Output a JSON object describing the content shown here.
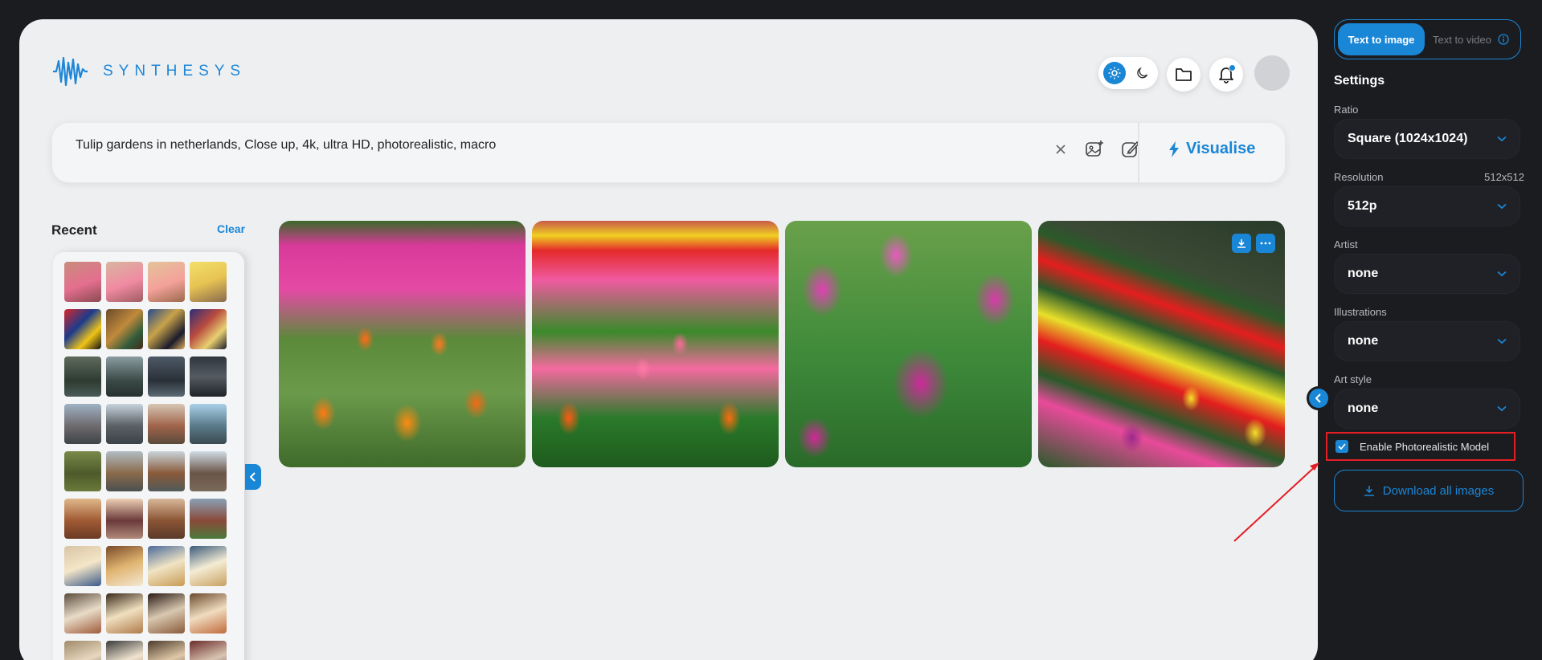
{
  "app": {
    "logo_text": "SYNTHESYS"
  },
  "prompt": {
    "value": "Tulip gardens in netherlands, Close up, 4k, ultra HD, photorealistic, macro",
    "submit_label": "Visualise"
  },
  "recent": {
    "title": "Recent",
    "clear_label": "Clear"
  },
  "sidebar": {
    "tabs": {
      "active": "Text to image",
      "inactive": "Text to video"
    },
    "settings_title": "Settings",
    "ratio": {
      "label": "Ratio",
      "value": "Square (1024x1024)"
    },
    "resolution": {
      "label": "Resolution",
      "extra": "512x512",
      "value": "512p"
    },
    "artist": {
      "label": "Artist",
      "value": "none"
    },
    "illustrations": {
      "label": "Illustrations",
      "value": "none"
    },
    "art_style": {
      "label": "Art style",
      "value": "none"
    },
    "photorealistic": {
      "label": "Enable Photorealistic Model",
      "checked": true
    },
    "download_all_label": "Download all images"
  },
  "colors": {
    "accent": "#1a86d6",
    "highlight": "#e31e24",
    "background": "#1b1c20",
    "panel": "#eeeff1"
  }
}
